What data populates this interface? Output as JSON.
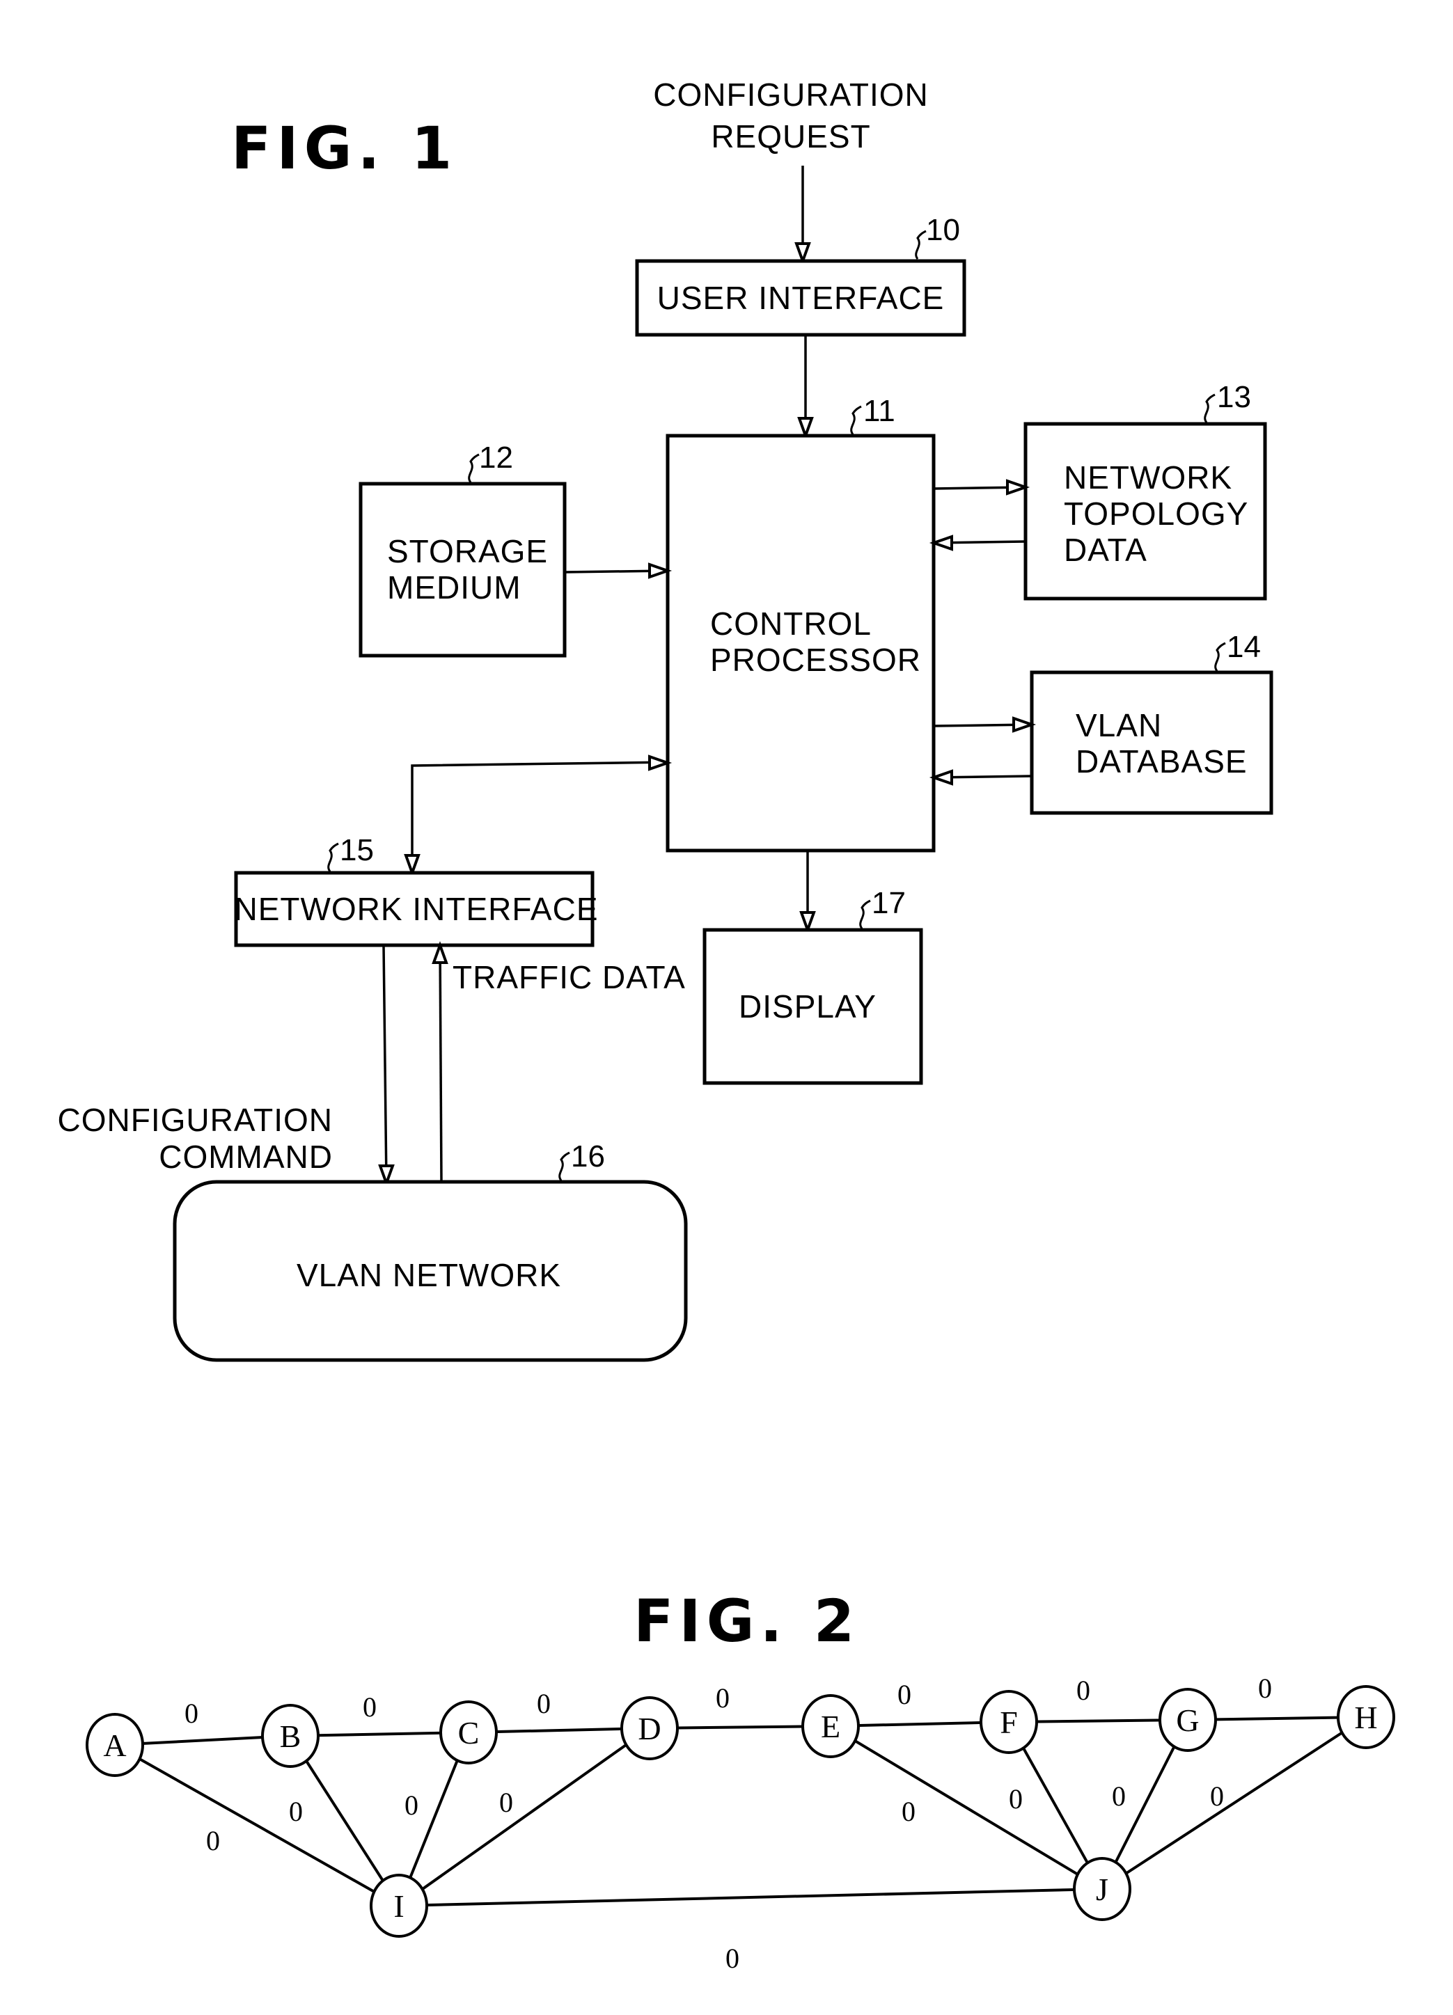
{
  "fig1": {
    "title": "FIG. 1",
    "input_label": [
      "CONFIGURATION",
      "REQUEST"
    ],
    "blocks": {
      "user_interface": {
        "ref": "10",
        "lines": [
          "USER INTERFACE"
        ]
      },
      "control_processor": {
        "ref": "11",
        "lines": [
          "CONTROL",
          "PROCESSOR"
        ]
      },
      "storage_medium": {
        "ref": "12",
        "lines": [
          "STORAGE",
          "MEDIUM"
        ]
      },
      "network_topology_data": {
        "ref": "13",
        "lines": [
          "NETWORK",
          "TOPOLOGY",
          "DATA"
        ]
      },
      "vlan_database": {
        "ref": "14",
        "lines": [
          "VLAN",
          "DATABASE"
        ]
      },
      "network_interface": {
        "ref": "15",
        "lines": [
          "NETWORK INTERFACE"
        ]
      },
      "vlan_network": {
        "ref": "16",
        "lines": [
          "VLAN NETWORK"
        ]
      },
      "display": {
        "ref": "17",
        "lines": [
          "DISPLAY"
        ]
      }
    },
    "traffic_label": "TRAFFIC DATA",
    "command_label": [
      "CONFIGURATION",
      "COMMAND"
    ]
  },
  "fig2": {
    "title": "FIG. 2",
    "nodes": [
      "A",
      "B",
      "C",
      "D",
      "E",
      "F",
      "G",
      "H",
      "I",
      "J"
    ],
    "edges": [
      {
        "from": "A",
        "to": "B",
        "weight": "0"
      },
      {
        "from": "B",
        "to": "C",
        "weight": "0"
      },
      {
        "from": "C",
        "to": "D",
        "weight": "0"
      },
      {
        "from": "D",
        "to": "E",
        "weight": "0"
      },
      {
        "from": "E",
        "to": "F",
        "weight": "0"
      },
      {
        "from": "F",
        "to": "G",
        "weight": "0"
      },
      {
        "from": "G",
        "to": "H",
        "weight": "0"
      },
      {
        "from": "A",
        "to": "I",
        "weight": "0"
      },
      {
        "from": "B",
        "to": "I",
        "weight": "0"
      },
      {
        "from": "C",
        "to": "I",
        "weight": "0"
      },
      {
        "from": "D",
        "to": "I",
        "weight": "0"
      },
      {
        "from": "E",
        "to": "J",
        "weight": "0"
      },
      {
        "from": "F",
        "to": "J",
        "weight": "0"
      },
      {
        "from": "G",
        "to": "J",
        "weight": "0"
      },
      {
        "from": "H",
        "to": "J",
        "weight": "0"
      },
      {
        "from": "I",
        "to": "J",
        "weight": "0"
      }
    ]
  }
}
